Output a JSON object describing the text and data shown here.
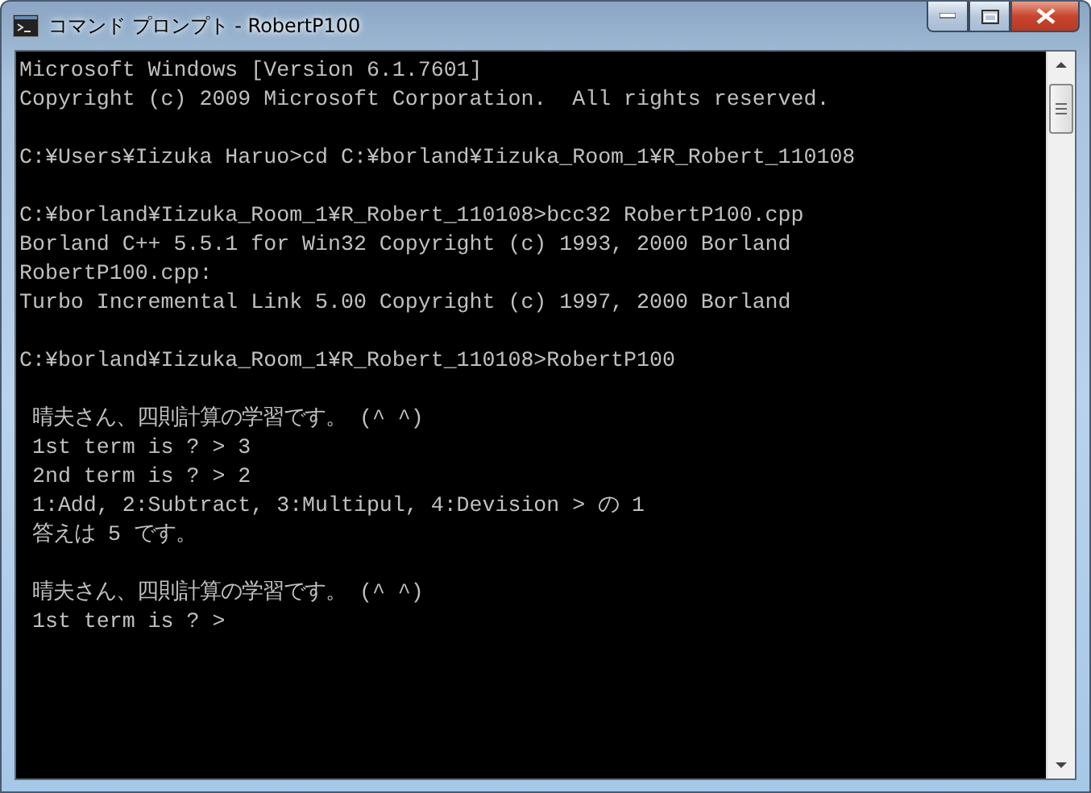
{
  "window": {
    "title": "コマンド プロンプト - RobertP100"
  },
  "console": {
    "blocks": [
      [
        "Microsoft Windows [Version 6.1.7601]",
        "Copyright (c) 2009 Microsoft Corporation.  All rights reserved."
      ],
      [
        "C:¥Users¥Iizuka Haruo>cd C:¥borland¥Iizuka_Room_1¥R_Robert_110108"
      ],
      [
        "C:¥borland¥Iizuka_Room_1¥R_Robert_110108>bcc32 RobertP100.cpp",
        "Borland C++ 5.5.1 for Win32 Copyright (c) 1993, 2000 Borland",
        "RobertP100.cpp:",
        "Turbo Incremental Link 5.00 Copyright (c) 1997, 2000 Borland"
      ],
      [
        "C:¥borland¥Iizuka_Room_1¥R_Robert_110108>RobertP100"
      ],
      [
        " 晴夫さん、四則計算の学習です。 (^ ^)",
        " 1st term is ? > 3",
        " 2nd term is ? > 2",
        " 1:Add, 2:Subtract, 3:Multipul, 4:Devision > の 1",
        " 答えは 5 です。"
      ],
      [
        " 晴夫さん、四則計算の学習です。 (^ ^)",
        " 1st term is ? >"
      ]
    ]
  }
}
